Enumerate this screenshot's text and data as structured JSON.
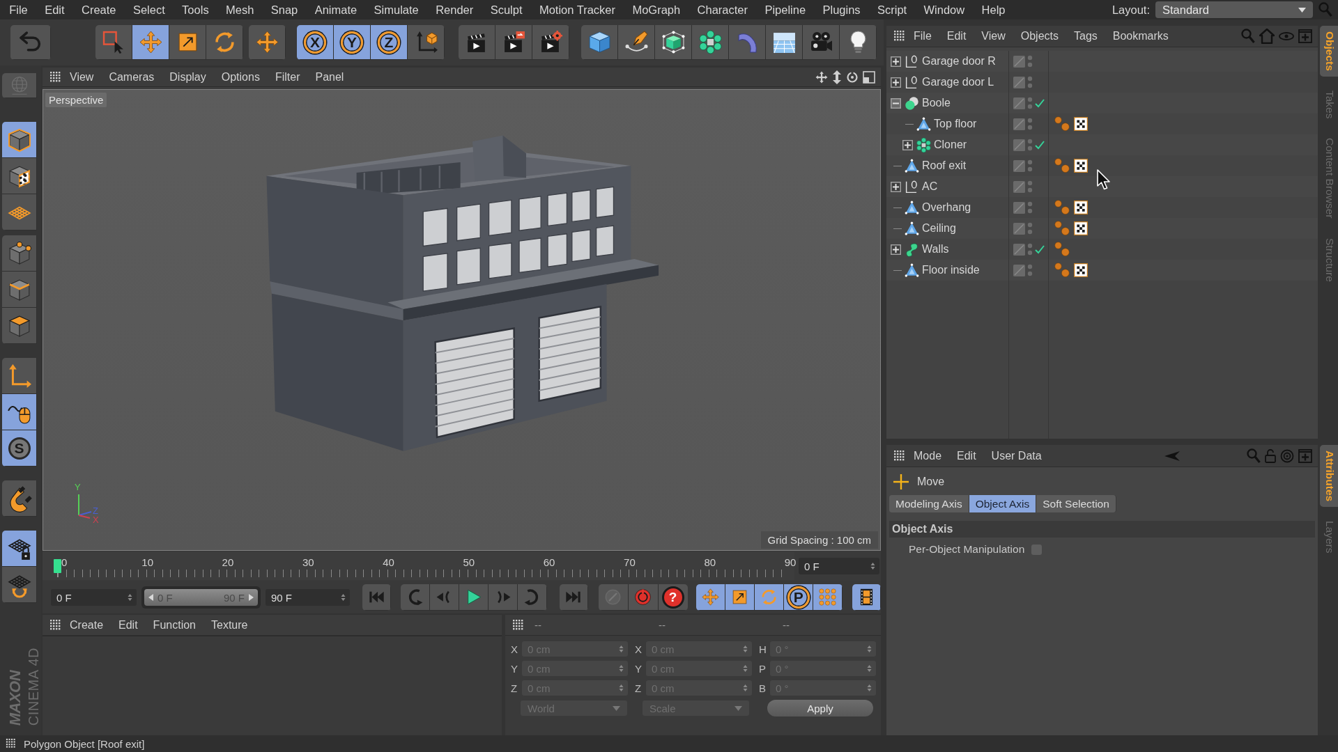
{
  "menu_bar": {
    "items": [
      "File",
      "Edit",
      "Create",
      "Select",
      "Tools",
      "Mesh",
      "Snap",
      "Animate",
      "Simulate",
      "Render",
      "Sculpt",
      "Motion Tracker",
      "MoGraph",
      "Character",
      "Pipeline",
      "Plugins",
      "Script",
      "Window",
      "Help"
    ],
    "layout_label": "Layout:",
    "layout_value": "Standard"
  },
  "toolbar": {
    "groups": [
      [
        {
          "kind": "undo",
          "active": false
        }
      ],
      [
        {
          "kind": "live-selection",
          "active": false
        },
        {
          "kind": "move",
          "active": true
        },
        {
          "kind": "scale",
          "active": false
        },
        {
          "kind": "rotate",
          "active": false
        }
      ],
      [
        {
          "kind": "last-tool",
          "active": false
        }
      ],
      [
        {
          "kind": "axis-lock",
          "label": "X",
          "active": true
        },
        {
          "kind": "axis-lock",
          "label": "Y",
          "active": true
        },
        {
          "kind": "axis-lock",
          "label": "Z",
          "active": true
        },
        {
          "kind": "coordinate-system",
          "active": false
        }
      ],
      [
        {
          "kind": "render-view",
          "active": false
        },
        {
          "kind": "render-viewer",
          "active": false
        },
        {
          "kind": "render-settings",
          "active": false
        }
      ],
      [
        {
          "kind": "cube",
          "active": false
        },
        {
          "kind": "pen",
          "active": false
        },
        {
          "kind": "subdivision",
          "active": false
        },
        {
          "kind": "cloner",
          "active": false
        },
        {
          "kind": "bend",
          "active": false
        },
        {
          "kind": "floor",
          "active": false
        },
        {
          "kind": "camera",
          "active": false
        },
        {
          "kind": "light",
          "active": false
        }
      ]
    ]
  },
  "left_tools": {
    "groups": [
      [
        {
          "kind": "make-editable",
          "active": false
        }
      ],
      [
        {
          "kind": "model-mode",
          "active": true
        },
        {
          "kind": "texture-mode",
          "active": false
        },
        {
          "kind": "workplane-mode",
          "active": false
        }
      ],
      [
        {
          "kind": "points-mode",
          "active": false
        },
        {
          "kind": "edges-mode",
          "active": false
        },
        {
          "kind": "polygons-mode",
          "active": false
        }
      ],
      [
        {
          "kind": "axis-mode",
          "active": false
        },
        {
          "kind": "tweak-mode",
          "active": true
        },
        {
          "kind": "solo",
          "label": "S",
          "active": true
        }
      ],
      [
        {
          "kind": "snap",
          "active": false
        }
      ],
      [
        {
          "kind": "workplane-lock",
          "active": true
        },
        {
          "kind": "workplane-align",
          "active": false
        }
      ]
    ]
  },
  "logo": {
    "brand": "MAXON",
    "product": "CINEMA 4D"
  },
  "viewport": {
    "menu": [
      "View",
      "Cameras",
      "Display",
      "Options",
      "Filter",
      "Panel"
    ],
    "camera": "Perspective",
    "axis_labels": [
      "Y",
      "Z",
      "X"
    ],
    "grid_spacing": "Grid Spacing : 100 cm"
  },
  "timeline": {
    "ticks": [
      "0",
      "10",
      "20",
      "30",
      "40",
      "50",
      "60",
      "70",
      "80",
      "90"
    ],
    "level": 0,
    "frame": "0 F"
  },
  "playback": {
    "start": "0 F",
    "range": {
      "start": "0 F",
      "end": "90 F",
      "level": 1
    },
    "end": "90 F",
    "groups": [
      [
        {
          "kind": "go-start",
          "active": false
        }
      ],
      [
        {
          "kind": "previous-key",
          "active": false
        },
        {
          "kind": "previous-frame",
          "active": false
        },
        {
          "kind": "play",
          "active": false
        },
        {
          "kind": "next-frame",
          "active": false
        },
        {
          "kind": "next-key",
          "active": false
        }
      ],
      [
        {
          "kind": "go-end",
          "active": false
        }
      ],
      [
        {
          "kind": "record",
          "active": false
        },
        {
          "kind": "autokey",
          "active": false
        },
        {
          "kind": "key-selection",
          "label": "?",
          "active": false
        }
      ],
      [
        {
          "kind": "key-position",
          "active": true
        },
        {
          "kind": "key-scale",
          "active": true
        },
        {
          "kind": "key-rotation",
          "active": true
        },
        {
          "kind": "key-parameter",
          "label": "P",
          "active": true
        },
        {
          "kind": "key-points",
          "active": true
        }
      ],
      [
        {
          "kind": "timeline",
          "active": true
        }
      ]
    ]
  },
  "materials": {
    "menu": [
      "Create",
      "Edit",
      "Function",
      "Texture"
    ]
  },
  "coordinates": {
    "headers": [
      "--",
      "--",
      "--"
    ],
    "disabled": true,
    "columns": [
      [
        {
          "axis": "X",
          "value": "0 cm"
        },
        {
          "axis": "Y",
          "value": "0 cm"
        },
        {
          "axis": "Z",
          "value": "0 cm"
        }
      ],
      [
        {
          "axis": "X",
          "value": "0 cm"
        },
        {
          "axis": "Y",
          "value": "0 cm"
        },
        {
          "axis": "Z",
          "value": "0 cm"
        }
      ],
      [
        {
          "axis": "H",
          "value": "0 °"
        },
        {
          "axis": "P",
          "value": "0 °"
        },
        {
          "axis": "B",
          "value": "0 °"
        }
      ]
    ],
    "dropdowns": [
      "World",
      "Scale"
    ],
    "apply": "Apply"
  },
  "objects": {
    "menu": [
      "File",
      "Edit",
      "View",
      "Objects",
      "Tags",
      "Bookmarks"
    ],
    "tree": [
      {
        "name": "Garage door R",
        "kind": "null",
        "expandable": true,
        "expanded": false,
        "check": false
      },
      {
        "name": "Garage door L",
        "kind": "null",
        "expandable": true,
        "expanded": false,
        "check": false
      },
      {
        "name": "Boole",
        "kind": "boole",
        "expandable": true,
        "expanded": true,
        "check": true,
        "children": [
          {
            "name": "Top floor",
            "kind": "polygon",
            "expandable": false,
            "expanded": false,
            "check": false,
            "tags": [
              {
                "kind": "phong"
              },
              {
                "kind": "material"
              }
            ]
          },
          {
            "name": "Cloner",
            "kind": "cloner",
            "expandable": true,
            "expanded": false,
            "check": true
          }
        ]
      },
      {
        "name": "Roof exit",
        "kind": "polygon",
        "expandable": false,
        "expanded": false,
        "check": false,
        "tags": [
          {
            "kind": "phong"
          },
          {
            "kind": "material"
          }
        ]
      },
      {
        "name": "AC",
        "kind": "null",
        "expandable": true,
        "expanded": false,
        "check": false
      },
      {
        "name": "Overhang",
        "kind": "polygon",
        "expandable": false,
        "expanded": false,
        "check": false,
        "tags": [
          {
            "kind": "phong"
          },
          {
            "kind": "material"
          }
        ]
      },
      {
        "name": "Ceiling",
        "kind": "polygon",
        "expandable": false,
        "expanded": false,
        "check": false,
        "tags": [
          {
            "kind": "phong"
          },
          {
            "kind": "material"
          }
        ]
      },
      {
        "name": "Walls",
        "kind": "sweep",
        "expandable": true,
        "expanded": false,
        "check": true,
        "tags": [
          {
            "kind": "phong"
          }
        ]
      },
      {
        "name": "Floor inside",
        "kind": "polygon",
        "expandable": false,
        "expanded": false,
        "check": false,
        "tags": [
          {
            "kind": "phong"
          },
          {
            "kind": "material"
          }
        ]
      }
    ]
  },
  "attributes": {
    "menu": [
      "Mode",
      "Edit",
      "User Data"
    ],
    "tool": "Move",
    "tabs": [
      {
        "label": "Modeling Axis",
        "selected": false
      },
      {
        "label": "Object Axis",
        "selected": true
      },
      {
        "label": "Soft Selection",
        "selected": false
      }
    ],
    "section": "Object Axis",
    "options": [
      {
        "label": "Per-Object Manipulation",
        "checked": false
      }
    ]
  },
  "side_tabs": {
    "top": [
      {
        "label": "Objects",
        "selected": true
      },
      {
        "label": "Takes",
        "selected": false
      },
      {
        "label": "Content Browser",
        "selected": false
      },
      {
        "label": "Structure",
        "selected": false
      }
    ],
    "bottom": [
      {
        "label": "Attributes",
        "selected": true
      },
      {
        "label": "Layers",
        "selected": false
      }
    ]
  },
  "status_bar": "Polygon Object [Roof exit]"
}
